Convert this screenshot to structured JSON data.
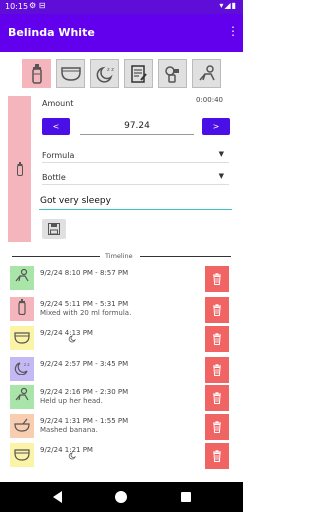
{
  "status": {
    "time": "10:15",
    "left_icons": "⚙ ⊟",
    "right_icons": "▾◢▮"
  },
  "app": {
    "title": "Belinda White",
    "menu_glyph": "⋮"
  },
  "categories": [
    {
      "name": "bottle-icon",
      "active": true
    },
    {
      "name": "diaper-icon",
      "active": false
    },
    {
      "name": "sleep-moon-icon",
      "active": false
    },
    {
      "name": "note-icon",
      "active": false
    },
    {
      "name": "pump-icon",
      "active": false
    },
    {
      "name": "crawling-baby-icon",
      "active": false
    }
  ],
  "form": {
    "amount_label": "Amount",
    "elapsed": "0:00:40",
    "decrement": "<",
    "increment": ">",
    "amount_value": "97.24",
    "food_type": "Formula",
    "container": "Bottle",
    "note_value": "Got very sleepy"
  },
  "timeline": {
    "label": "Timeline",
    "entries": [
      {
        "icon": "crawling-baby-icon",
        "tile_color": "#a9e5a9",
        "line1": "9/2/24  8:10 PM - 8:57 PM",
        "line2": ""
      },
      {
        "icon": "bottle-icon",
        "tile_color": "#f4b5bd",
        "line1": "9/2/24  5:11 PM - 5:31 PM",
        "line2": "Mixed with 20 ml formula."
      },
      {
        "icon": "diaper-icon",
        "tile_color": "#fbf4a6",
        "line1": "9/2/24   4:13 PM",
        "line2": "",
        "small_icon": true
      },
      {
        "icon": "sleep-moon-icon",
        "tile_color": "#c4b8f5",
        "line1": "9/2/24  2:57 PM - 3:45 PM",
        "line2": ""
      },
      {
        "icon": "crawling-baby-icon",
        "tile_color": "#a9e5a9",
        "line1": "9/2/24  2:16 PM - 2:30 PM",
        "line2": "Held up her head."
      },
      {
        "icon": "bowl-icon",
        "tile_color": "#f9cdb0",
        "line1": "9/2/24  1:31 PM - 1:55 PM",
        "line2": "Mashed banana."
      },
      {
        "icon": "diaper-icon",
        "tile_color": "#fbf4a6",
        "line1": "9/2/24   1:21 PM",
        "line2": "",
        "small_icon": true
      }
    ]
  }
}
